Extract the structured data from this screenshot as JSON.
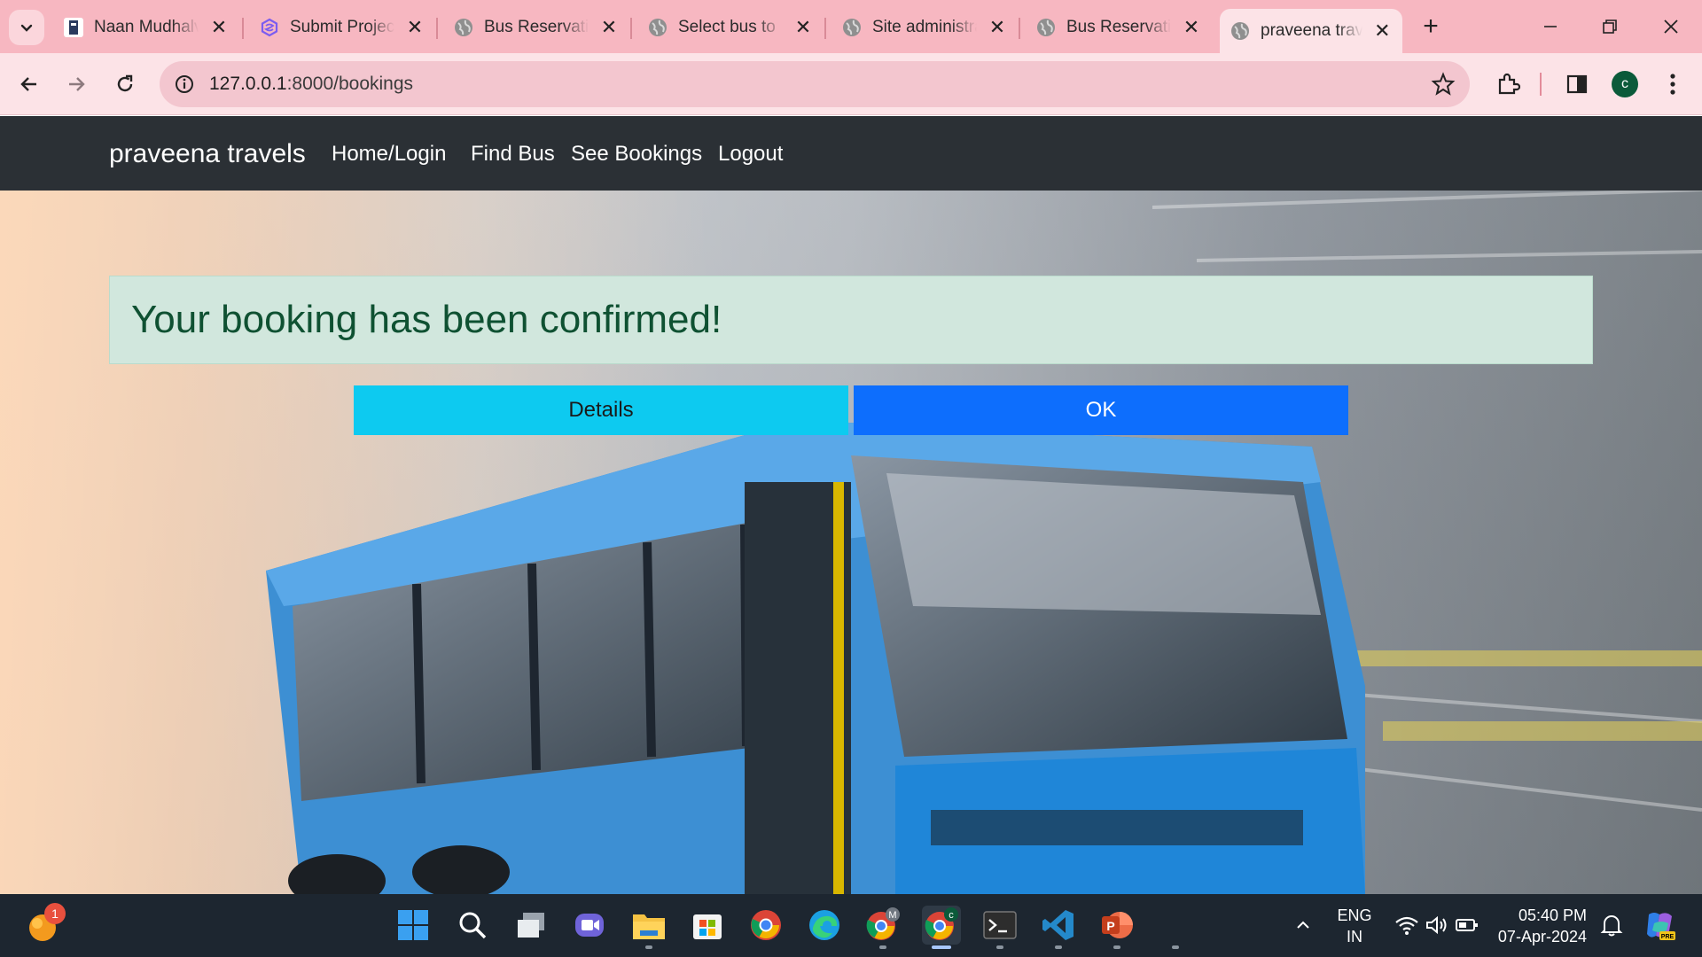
{
  "browser": {
    "tabs": [
      {
        "title": "Naan Mudhalvan",
        "favicon": "naan-mudhalvan-icon",
        "active": false
      },
      {
        "title": "Submit Project",
        "favicon": "project-submit-icon",
        "active": false
      },
      {
        "title": "Bus Reservation",
        "favicon": "globe-icon",
        "active": false
      },
      {
        "title": "Select bus to",
        "favicon": "globe-icon",
        "active": false
      },
      {
        "title": "Site administration",
        "favicon": "globe-icon",
        "active": false
      },
      {
        "title": "Bus Reservation",
        "favicon": "globe-icon",
        "active": false
      },
      {
        "title": "praveena travels",
        "favicon": "globe-icon",
        "active": true
      }
    ],
    "url_host": "127.0.0.1",
    "url_path": ":8000/bookings",
    "profile_initial": "c",
    "colors": {
      "tabstrip": "#f7b7c1",
      "toolbar": "#fce3e7",
      "omnibox": "#f3c6cf"
    }
  },
  "site": {
    "brand": "praveena travels",
    "nav": [
      "Home/Login",
      "Find Bus",
      "See Bookings",
      "Logout"
    ],
    "alert_text": "Your booking has been confirmed!",
    "buttons": {
      "details": "Details",
      "ok": "OK"
    },
    "colors": {
      "navbar": "#2b3035",
      "alert_bg": "#d1e7dd",
      "alert_text": "#0f5132",
      "details": "#0dcaf0",
      "ok": "#0d6efd"
    }
  },
  "taskbar": {
    "notification_count": "1",
    "apps": [
      "start-icon",
      "search-icon",
      "task-view-icon",
      "teams-icon",
      "file-explorer-icon",
      "microsoft-store-icon",
      "chrome-icon",
      "edge-icon",
      "chrome-profile-m-icon",
      "chrome-profile-c-icon",
      "terminal-icon",
      "vscode-icon",
      "powerpoint-icon"
    ],
    "lang_line1": "ENG",
    "lang_line2": "IN",
    "time": "05:40 PM",
    "date": "07-Apr-2024"
  }
}
